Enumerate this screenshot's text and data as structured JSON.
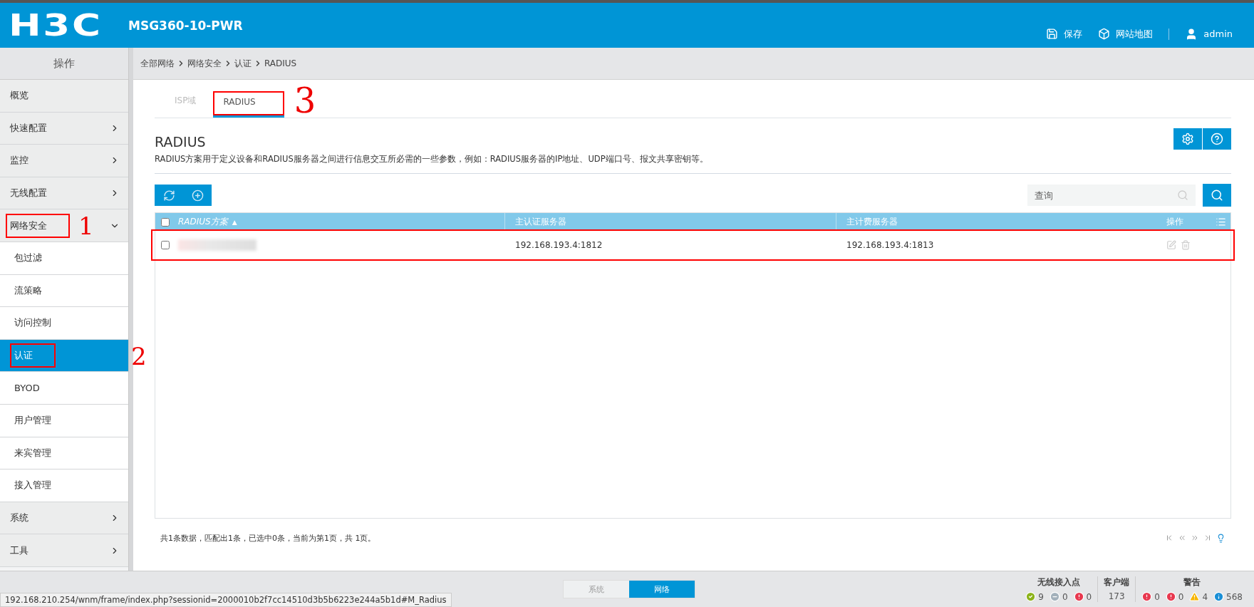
{
  "header": {
    "logo": "H3C",
    "device": "MSG360-10-PWR",
    "actions": [
      {
        "kind": "save",
        "label": "保存"
      },
      {
        "kind": "sitemap",
        "label": "网站地图"
      },
      {
        "kind": "user",
        "label": "admin"
      }
    ]
  },
  "sidebar": {
    "title": "操作",
    "items": [
      {
        "label": "概览",
        "kind": "plain",
        "selected": false
      },
      {
        "label": "快速配置",
        "kind": "group",
        "expanded": false,
        "selected": false
      },
      {
        "label": "监控",
        "kind": "group",
        "expanded": false,
        "selected": false
      },
      {
        "label": "无线配置",
        "kind": "group",
        "expanded": false,
        "selected": false
      },
      {
        "label": "网络安全",
        "kind": "group",
        "expanded": true,
        "selected": false,
        "annotation": "1",
        "children": [
          {
            "label": "包过滤",
            "selected": false
          },
          {
            "label": "流策略",
            "selected": false
          },
          {
            "label": "访问控制",
            "selected": false
          },
          {
            "label": "认证",
            "selected": true,
            "annotation": "2"
          },
          {
            "label": "BYOD",
            "selected": false
          },
          {
            "label": "用户管理",
            "selected": false
          },
          {
            "label": "来宾管理",
            "selected": false
          },
          {
            "label": "接入管理",
            "selected": false
          }
        ]
      },
      {
        "label": "系统",
        "kind": "group",
        "expanded": false,
        "selected": false
      },
      {
        "label": "工具",
        "kind": "group",
        "expanded": false,
        "selected": false
      }
    ]
  },
  "breadcrumb": [
    "全部网络",
    "网络安全",
    "认证",
    "RADIUS"
  ],
  "tabs": [
    {
      "label": "ISP域",
      "selected": false
    },
    {
      "label": "RADIUS",
      "selected": true,
      "annotation": "3"
    }
  ],
  "section": {
    "title": "RADIUS",
    "description": "RADIUS方案用于定义设备和RADIUS服务器之间进行信息交互所必需的一些参数，例如：RADIUS服务器的IP地址、UDP端口号、报文共享密钥等。"
  },
  "search": {
    "placeholder": "查询"
  },
  "table": {
    "all_checked": false,
    "sort_indicator": "▲",
    "columns": [
      "RADIUS方案",
      "主认证服务器",
      "主计费服务器",
      "操作"
    ],
    "rows": [
      {
        "checked": false,
        "redacted": true,
        "auth": "192.168.193.4:1812",
        "acct": "192.168.193.4:1813",
        "marked": true
      }
    ]
  },
  "pagination": "共1条数据，匹配出1条，已选中0条，当前为第1页，共 1页。",
  "footer": {
    "switch": [
      {
        "label": "系统",
        "selected": false
      },
      {
        "label": "网络",
        "selected": true
      }
    ],
    "ap": {
      "title": "无线接入点",
      "counts": [
        {
          "kind": "ok",
          "value": "9"
        },
        {
          "kind": "off",
          "value": "0"
        },
        {
          "kind": "error",
          "value": "0"
        }
      ]
    },
    "clients": {
      "title": "客户端",
      "value": "173"
    },
    "alarms": {
      "title": "警告",
      "counts": [
        {
          "kind": "error",
          "value": "0"
        },
        {
          "kind": "error",
          "value": "0"
        },
        {
          "kind": "warning",
          "value": "4"
        },
        {
          "kind": "info",
          "value": "568"
        }
      ]
    }
  },
  "status_url": "192.168.210.254/wnm/frame/index.php?sessionid=2000010b2f7cc14510d3b5b6223e244a5b1d#M_Radius"
}
